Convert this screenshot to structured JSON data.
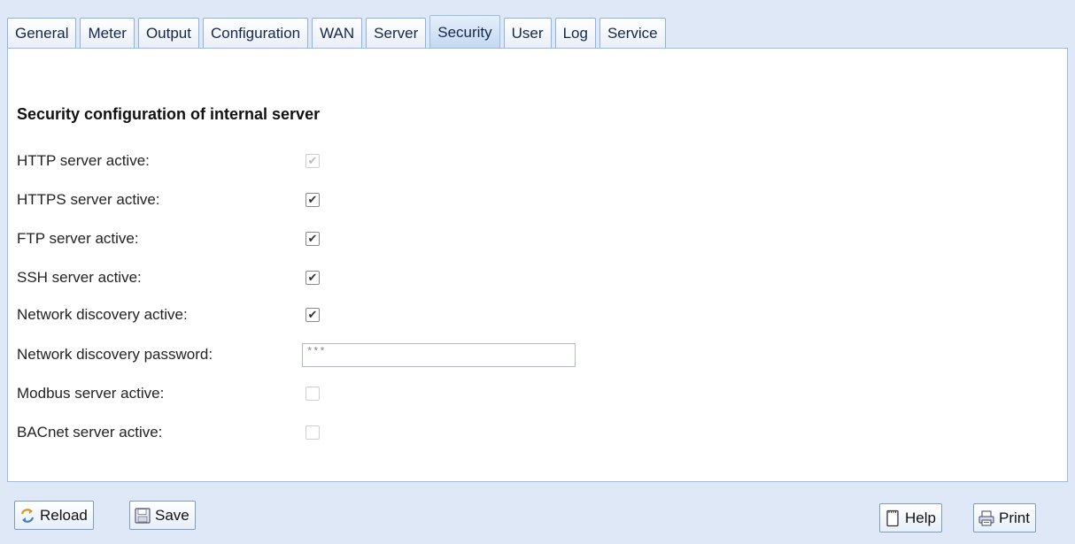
{
  "tabs": [
    "General",
    "Meter",
    "Output",
    "Configuration",
    "WAN",
    "Server",
    "Security",
    "User",
    "Log",
    "Service"
  ],
  "active_tab": "Security",
  "section_title": "Security configuration of internal server",
  "fields": {
    "http": {
      "label": "HTTP server active:",
      "checked": true,
      "disabled": true
    },
    "https": {
      "label": "HTTPS server active:",
      "checked": true,
      "disabled": false
    },
    "ftp": {
      "label": "FTP server active:",
      "checked": true,
      "disabled": false
    },
    "ssh": {
      "label": "SSH server active:",
      "checked": true,
      "disabled": false
    },
    "discovery": {
      "label": "Network discovery active:",
      "checked": true,
      "disabled": false
    },
    "discovery_password": {
      "label": "Network discovery password:",
      "value": "***"
    },
    "modbus": {
      "label": "Modbus server active:",
      "checked": false,
      "disabled": true
    },
    "bacnet": {
      "label": "BACnet server active:",
      "checked": false,
      "disabled": true
    }
  },
  "buttons": {
    "reload": "Reload",
    "save": "Save",
    "help": "Help",
    "print": "Print"
  },
  "icons": {
    "reload": "reload-arrows-icon",
    "save": "floppy-disk-icon",
    "help": "help-page-icon",
    "print": "printer-icon"
  }
}
